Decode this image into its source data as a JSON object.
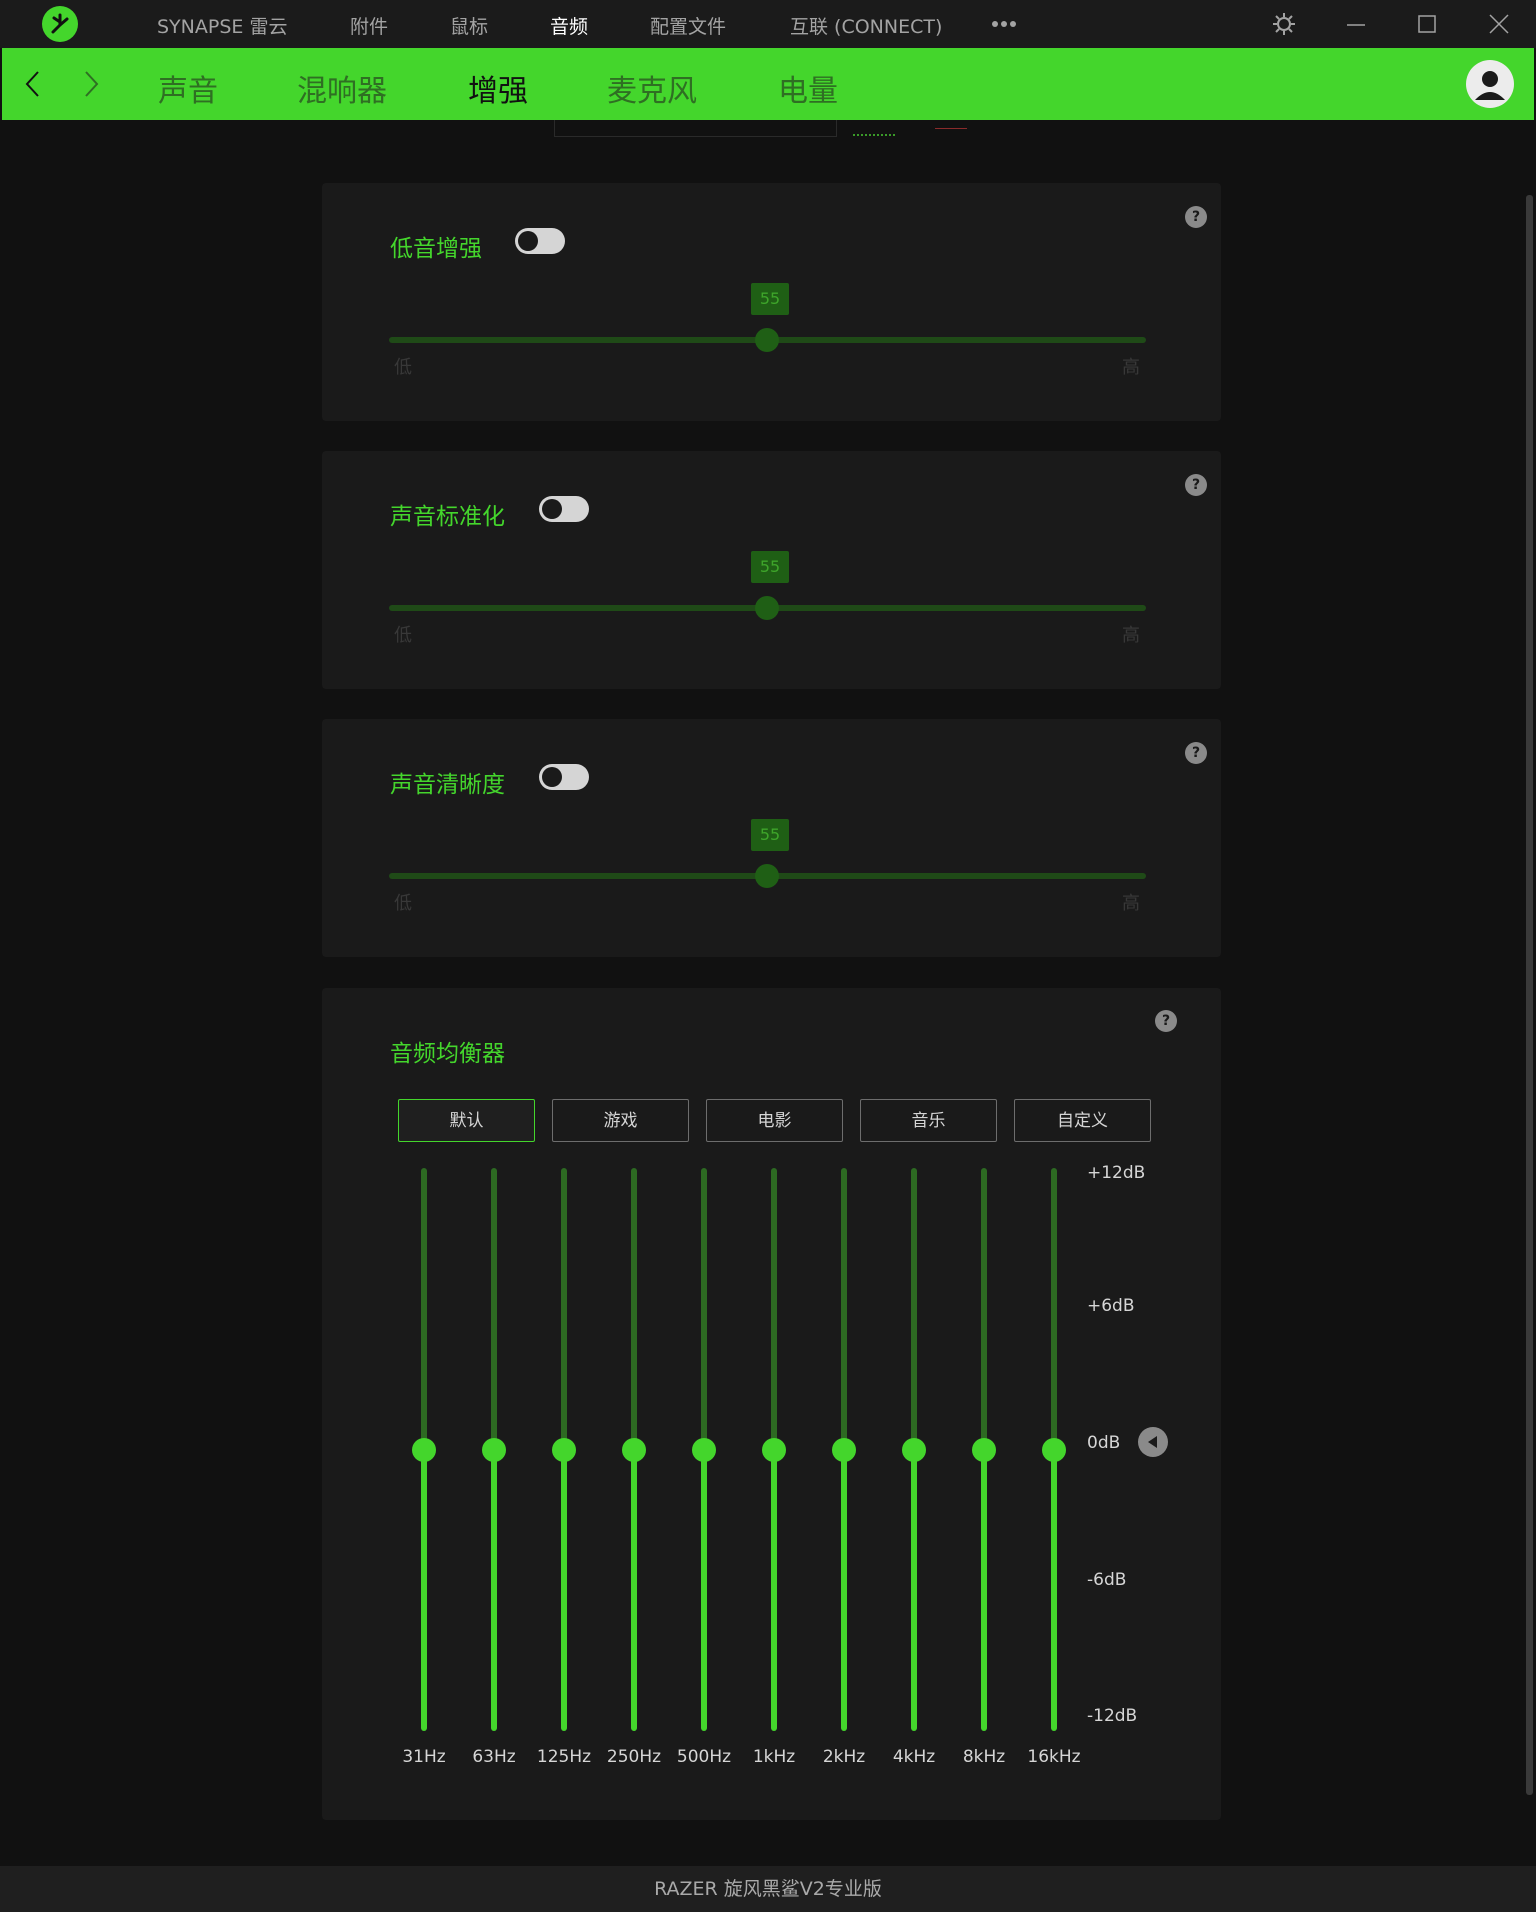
{
  "titlebar": {
    "nav": [
      "SYNAPSE 雷云",
      "附件",
      "鼠标",
      "音频",
      "配置文件",
      "互联 (CONNECT)"
    ],
    "active_nav": "音频",
    "more_icon": "more-dots-icon",
    "settings_icon": "gear-icon",
    "minimize_icon": "minimize-icon",
    "maximize_icon": "maximize-icon",
    "close_icon": "close-icon"
  },
  "subnav": {
    "tabs": [
      "声音",
      "混响器",
      "增强",
      "麦克风",
      "电量"
    ],
    "active_tab": "增强",
    "back_icon": "chevron-left-icon",
    "forward_icon": "chevron-right-icon",
    "avatar_icon": "user-avatar-icon"
  },
  "cards": [
    {
      "title": "低音增强",
      "enabled": false,
      "value": "55",
      "value_fraction": 0.5,
      "low_label": "低",
      "high_label": "高",
      "help": "?"
    },
    {
      "title": "声音标准化",
      "enabled": false,
      "value": "55",
      "value_fraction": 0.5,
      "low_label": "低",
      "high_label": "高",
      "help": "?"
    },
    {
      "title": "声音清晰度",
      "enabled": false,
      "value": "55",
      "value_fraction": 0.5,
      "low_label": "低",
      "high_label": "高",
      "help": "?"
    }
  ],
  "equalizer": {
    "title": "音频均衡器",
    "help": "?",
    "presets": [
      "默认",
      "游戏",
      "电影",
      "音乐",
      "自定义"
    ],
    "active_preset": "默认",
    "bands": [
      {
        "freq": "31Hz",
        "gain_db": 0
      },
      {
        "freq": "63Hz",
        "gain_db": 0
      },
      {
        "freq": "125Hz",
        "gain_db": 0
      },
      {
        "freq": "250Hz",
        "gain_db": 0
      },
      {
        "freq": "500Hz",
        "gain_db": 0
      },
      {
        "freq": "1kHz",
        "gain_db": 0
      },
      {
        "freq": "2kHz",
        "gain_db": 0
      },
      {
        "freq": "4kHz",
        "gain_db": 0
      },
      {
        "freq": "8kHz",
        "gain_db": 0
      },
      {
        "freq": "16kHz",
        "gain_db": 0
      }
    ],
    "db_scale": [
      "+12dB",
      "+6dB",
      "0dB",
      "-6dB",
      "-12dB"
    ],
    "db_range": [
      -12,
      12
    ],
    "reset_icon": "reset-triangle-icon"
  },
  "footer": {
    "device": "RAZER 旋风黑鲨V2专业版"
  },
  "colors": {
    "accent": "#44d62c",
    "background": "#111111",
    "card": "#1a1a1a",
    "titlebar": "#1b1b1b"
  }
}
